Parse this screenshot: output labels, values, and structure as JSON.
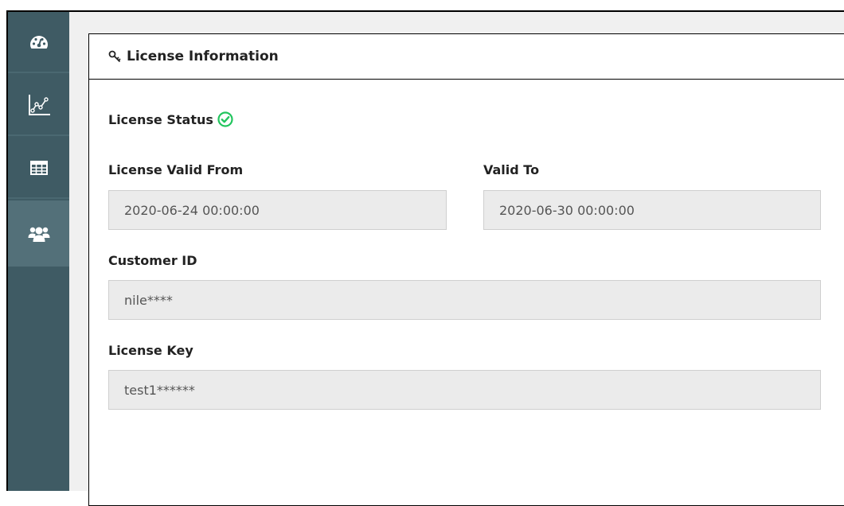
{
  "sidebar": {
    "items": [
      {
        "icon": "dashboard-icon",
        "active": false
      },
      {
        "icon": "chart-icon",
        "active": false
      },
      {
        "icon": "table-icon",
        "active": false
      },
      {
        "icon": "users-icon",
        "active": true
      }
    ]
  },
  "panel": {
    "icon": "key-icon",
    "title": "License Information"
  },
  "license": {
    "status_label": "License Status",
    "status_icon": "check-circle-icon",
    "status_color": "#22c55e",
    "valid_from_label": "License Valid From",
    "valid_from_value": "2020-06-24 00:00:00",
    "valid_to_label": "Valid To",
    "valid_to_value": "2020-06-30 00:00:00",
    "customer_id_label": "Customer ID",
    "customer_id_value": "nile****",
    "license_key_label": "License Key",
    "license_key_value": "test1******"
  },
  "colors": {
    "sidebar_bg": "#3f5b64",
    "sidebar_active": "#537079",
    "field_bg": "#ebebeb",
    "page_bg": "#f0f0f0"
  }
}
